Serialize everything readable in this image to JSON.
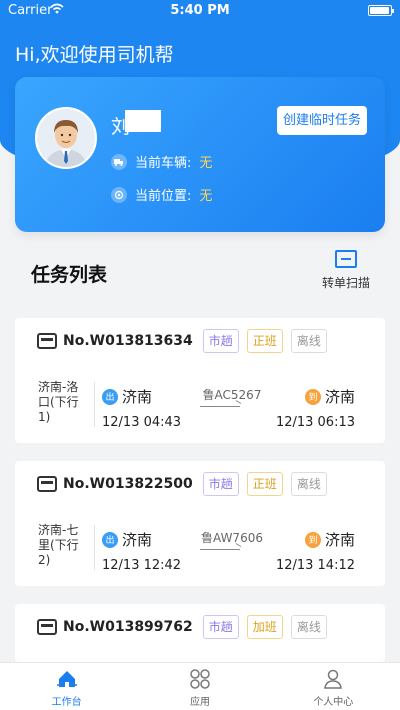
{
  "status_bar": {
    "carrier": "Carrier",
    "time": "5:40 PM"
  },
  "greeting": "Hi,欢迎使用司机帮",
  "profile": {
    "name": "刘",
    "create_task_label": "创建临时任务",
    "vehicle_label": "当前车辆:",
    "vehicle_value": "无",
    "location_label": "当前位置:",
    "location_value": "无"
  },
  "task_list": {
    "title": "任务列表",
    "scan_label": "转单扫描",
    "tasks": [
      {
        "no": "No.W013813634",
        "tags": [
          "市趟",
          "正班",
          "离线"
        ],
        "route": "济南-洛口(下行1)",
        "from": "济南",
        "to": "济南",
        "plate": "鲁AC5267",
        "depart": "12/13 04:43",
        "arrive": "12/13 06:13"
      },
      {
        "no": "No.W013822500",
        "tags": [
          "市趟",
          "正班",
          "离线"
        ],
        "route": "济南-七里(下行2)",
        "from": "济南",
        "to": "济南",
        "plate": "鲁AW7606",
        "depart": "12/13 12:42",
        "arrive": "12/13 14:12"
      },
      {
        "no": "No.W013899762",
        "tags": [
          "市趟",
          "加班",
          "离线"
        ]
      }
    ],
    "badge_out": "出",
    "badge_in": "到"
  },
  "tab_bar": {
    "items": [
      {
        "label": "工作台",
        "active": true
      },
      {
        "label": "应用",
        "active": false
      },
      {
        "label": "个人中心",
        "active": false
      }
    ]
  },
  "colors": {
    "primary": "#1a7ef0",
    "accent_yellow": "#ffd54f"
  }
}
